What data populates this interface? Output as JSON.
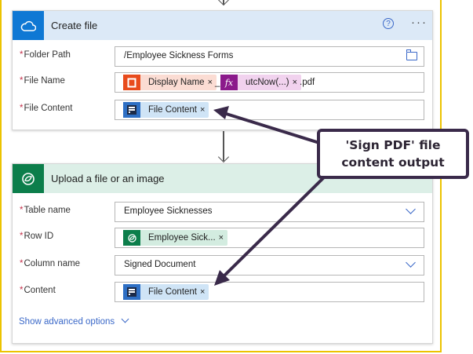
{
  "create_file": {
    "title": "Create file",
    "help_glyph": "?",
    "more_glyph": "···",
    "folder_path": {
      "label": "Folder Path",
      "value": "/Employee Sickness Forms"
    },
    "file_name": {
      "label": "File Name",
      "token1": {
        "label": "Display Name",
        "close": "×"
      },
      "separator": "_",
      "token2": {
        "icon_text": "fx",
        "label": "utcNow(...)",
        "close": "×"
      },
      "suffix": ".pdf"
    },
    "file_content": {
      "label": "File Content",
      "token": {
        "label": "File Content",
        "close": "×"
      }
    }
  },
  "upload_file": {
    "title": "Upload a file or an image",
    "table_name": {
      "label": "Table name",
      "value": "Employee Sicknesses"
    },
    "row_id": {
      "label": "Row ID",
      "token": {
        "label": "Employee Sick...",
        "close": "×"
      }
    },
    "column_name": {
      "label": "Column name",
      "value": "Signed Document"
    },
    "content": {
      "label": "Content",
      "token": {
        "label": "File Content",
        "close": "×"
      }
    },
    "show_advanced": "Show advanced options"
  },
  "required_marker": "*",
  "callout": {
    "line1": "'Sign PDF' file",
    "line2": "content output"
  },
  "colors": {
    "onedrive_blue": "#0f78d4",
    "dataverse_green": "#0c7e4b",
    "office_red": "#e84b1c",
    "expression_purple": "#8b1a8b",
    "token_pink": "#fbdcd3",
    "token_expr": "#f1d2ee",
    "token_blue": "#cfe4f6",
    "token_green": "#d3ece0",
    "callout_border": "#3a2a4a",
    "highlight_border": "#ecc300"
  },
  "icons": {
    "onedrive": "cloud-icon",
    "dataverse": "dataverse-icon",
    "office": "office-icon",
    "expression": "fx-icon",
    "sign_pdf": "sign-pdf-icon",
    "help": "question-circle-icon",
    "more": "more-ellipsis-icon",
    "folder": "folder-icon",
    "dropdown": "chevron-down-icon"
  }
}
